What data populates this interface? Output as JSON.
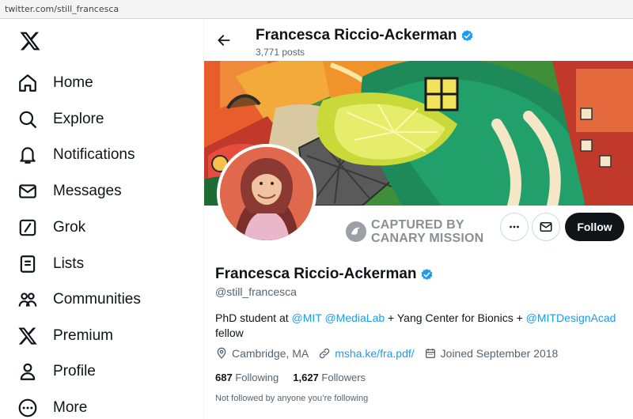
{
  "browser": {
    "url": "twitter.com/still_francesca"
  },
  "sidebar": {
    "items": [
      {
        "label": "Home",
        "icon": "home-icon"
      },
      {
        "label": "Explore",
        "icon": "search-icon"
      },
      {
        "label": "Notifications",
        "icon": "bell-icon"
      },
      {
        "label": "Messages",
        "icon": "envelope-icon"
      },
      {
        "label": "Grok",
        "icon": "grok-icon"
      },
      {
        "label": "Lists",
        "icon": "list-icon"
      },
      {
        "label": "Communities",
        "icon": "communities-icon"
      },
      {
        "label": "Premium",
        "icon": "x-logo-icon"
      },
      {
        "label": "Profile",
        "icon": "person-icon"
      },
      {
        "label": "More",
        "icon": "more-circle-icon"
      }
    ]
  },
  "header": {
    "name": "Francesca Riccio-Ackerman",
    "posts": "3,771 posts"
  },
  "watermark": {
    "line1": "CAPTURED BY",
    "line2": "CANARY MISSION"
  },
  "actions": {
    "follow_label": "Follow"
  },
  "profile": {
    "display_name": "Francesca Riccio-Ackerman",
    "handle": "@still_francesca",
    "bio": {
      "p1": "PhD student at ",
      "mit": "@MIT",
      "space": " ",
      "medialab": "@MediaLab",
      "p2": " + Yang Center for Bionics + ",
      "designacad": "@MITDesignAcad",
      "p3": "fellow"
    },
    "location": "Cambridge, MA",
    "website": "msha.ke/fra.pdf/",
    "joined": "Joined September 2018",
    "following_count": "687",
    "following_label": "Following",
    "followers_count": "1,627",
    "followers_label": "Followers",
    "not_followed": "Not followed by anyone you’re following"
  },
  "colors": {
    "accent": "#1d9bf0",
    "text": "#0f1419",
    "secondary": "#536471",
    "follow_button": "#0f1419",
    "watermark": "#8a8f94"
  }
}
